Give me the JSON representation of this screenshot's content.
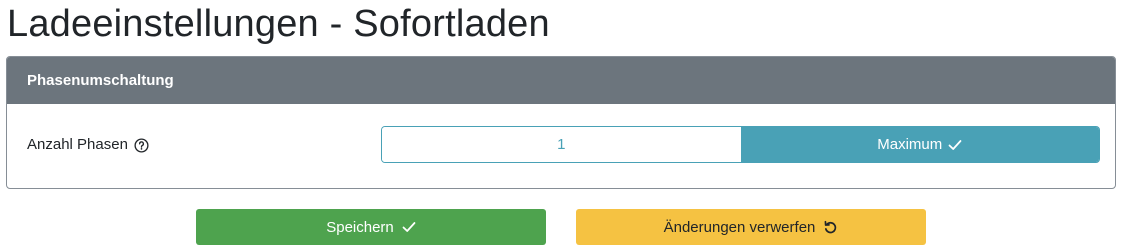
{
  "page": {
    "title": "Ladeeinstellungen - Sofortladen"
  },
  "card": {
    "header": "Phasenumschaltung",
    "field_label": "Anzahl Phasen",
    "help_icon": "question-circle-icon",
    "options": [
      {
        "label": "1",
        "selected": false
      },
      {
        "label": "Maximum",
        "selected": true,
        "icon": "check-icon"
      }
    ]
  },
  "actions": {
    "save_label": "Speichern",
    "save_icon": "check-icon",
    "discard_label": "Änderungen verwerfen",
    "discard_icon": "undo-icon"
  },
  "colors": {
    "header_bg": "#6c757d",
    "accent": "#49a1b6",
    "save_bg": "#4ea34e",
    "discard_bg": "#f5c242"
  }
}
